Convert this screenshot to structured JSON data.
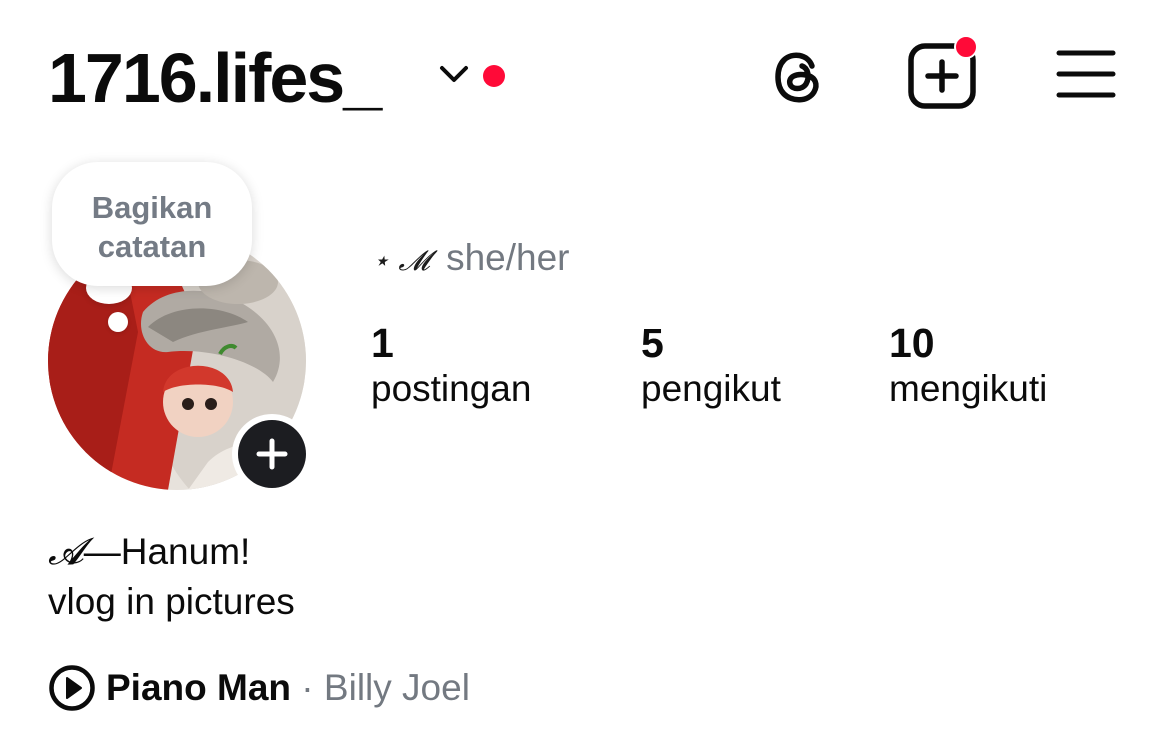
{
  "header": {
    "username": "1716.lifes_",
    "icons": [
      "chevron-down-icon",
      "threads-icon",
      "create-post-icon",
      "menu-icon"
    ],
    "notification_color": "#ff0a38"
  },
  "note": {
    "text": "Bagikan catatan"
  },
  "profile": {
    "pronouns_prefix": "⋆ 𝓜",
    "pronouns": "she/her",
    "stats": [
      {
        "value": "1",
        "label": "postingan"
      },
      {
        "value": "5",
        "label": "pengikut"
      },
      {
        "value": "10",
        "label": "mengikuti"
      }
    ]
  },
  "bio": {
    "line1_prefix": "𝓐",
    "line1": "—Hanum!",
    "line2": "vlog in pictures"
  },
  "music": {
    "title": "Piano Man",
    "separator": " · ",
    "artist": "Billy Joel"
  }
}
